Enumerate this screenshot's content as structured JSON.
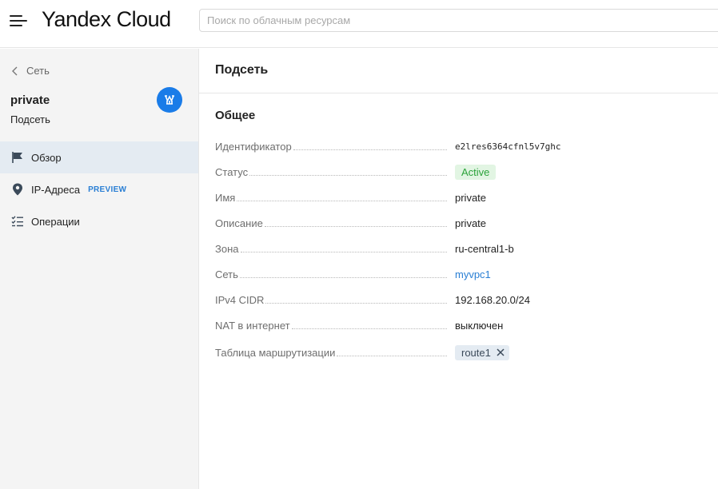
{
  "header": {
    "logo": "Yandex Cloud",
    "search_placeholder": "Поиск по облачным ресурсам"
  },
  "sidebar": {
    "back_label": "Сеть",
    "resource_name": "private",
    "resource_type": "Подсеть",
    "resource_icon": "subnet-icon",
    "items": [
      {
        "label": "Обзор",
        "icon": "flag-icon",
        "active": true
      },
      {
        "label": "IP-Адреса",
        "icon": "location-pin-icon",
        "badge": "PREVIEW"
      },
      {
        "label": "Операции",
        "icon": "checklist-icon"
      }
    ]
  },
  "main": {
    "title": "Подсеть",
    "section_title": "Общее",
    "properties": [
      {
        "key": "Идентификатор",
        "value": "e2lres6364cfnl5v7ghc"
      },
      {
        "key": "Статус",
        "value": "Active"
      },
      {
        "key": "Имя",
        "value": "private"
      },
      {
        "key": "Описание",
        "value": "private"
      },
      {
        "key": "Зона",
        "value": "ru-central1-b"
      },
      {
        "key": "Сеть",
        "value": "myvpc1"
      },
      {
        "key": "IPv4 CIDR",
        "value": "192.168.20.0/24"
      },
      {
        "key": "NAT в интернет",
        "value": "выключен"
      },
      {
        "key": "Таблица маршрутизации",
        "value": "route1"
      }
    ]
  },
  "colors": {
    "accent": "#1a7ce8",
    "link": "#2a7fd4",
    "status_active_bg": "#e2f5e3",
    "status_active_text": "#2aa33a",
    "active_nav_bg": "#e4ebf2"
  }
}
